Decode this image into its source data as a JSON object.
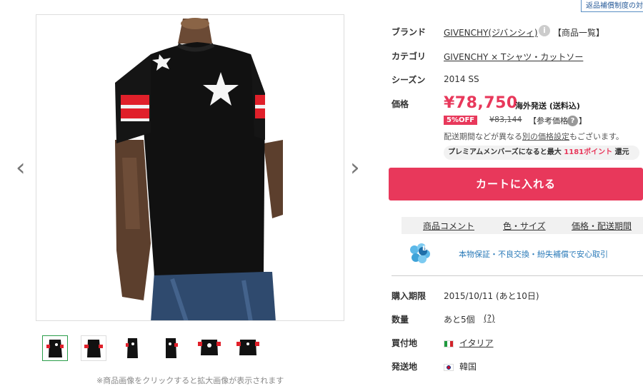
{
  "corner_tag": "返品補償制度の対象商品",
  "gallery": {
    "caption": "※商品画像をクリックすると拡大画像が表示されます",
    "prev_icon": "‹",
    "next_icon": "›",
    "thumb_count": 6
  },
  "product": {
    "brand_label": "ブランド",
    "brand_value": "GIVENCHY(ジバンシィ)",
    "brand_list_link": "【商品一覧】",
    "category_label": "カテゴリ",
    "category_value": "GIVENCHY × Tシャツ・カットソー",
    "season_label": "シーズン",
    "season_value": "2014 SS",
    "price_label": "価格",
    "price": "¥78,750",
    "shipping_note": "海外発送 (送料込)",
    "discount_badge": "5%OFF",
    "original_price": "¥83,144",
    "reference_price_label": "【参考価格",
    "reference_price_close": "】",
    "question_mark": "?",
    "delivery_note_prefix": "配送期間などが異なる",
    "delivery_note_link": "別の価格設定",
    "delivery_note_suffix": "もございます。",
    "premium_prefix": "プレミアムメンバーズになると最大 ",
    "premium_points": "1181ポイント",
    "premium_suffix": " 還元"
  },
  "cart_button": "カートに入れる",
  "tabs": [
    "商品コメント",
    "色・サイズ",
    "価格・配送期間"
  ],
  "guarantee": {
    "badge_letter": "B",
    "text": "本物保証・不良交換・紛失補償で安心取引"
  },
  "details": {
    "period_label": "購入期限",
    "period_value": "2015/10/11 (あと10日)",
    "qty_label": "数量",
    "qty_value": "あと5個",
    "qty_help": "(?)",
    "buy_loc_label": "買付地",
    "buy_loc_value": "イタリア",
    "ship_from_label": "発送地",
    "ship_from_value": "韓国"
  },
  "colors": {
    "accent": "#e8385b",
    "link_blue": "#2a7ab8",
    "shirt": "#111111",
    "stripe_red": "#e0202a"
  }
}
